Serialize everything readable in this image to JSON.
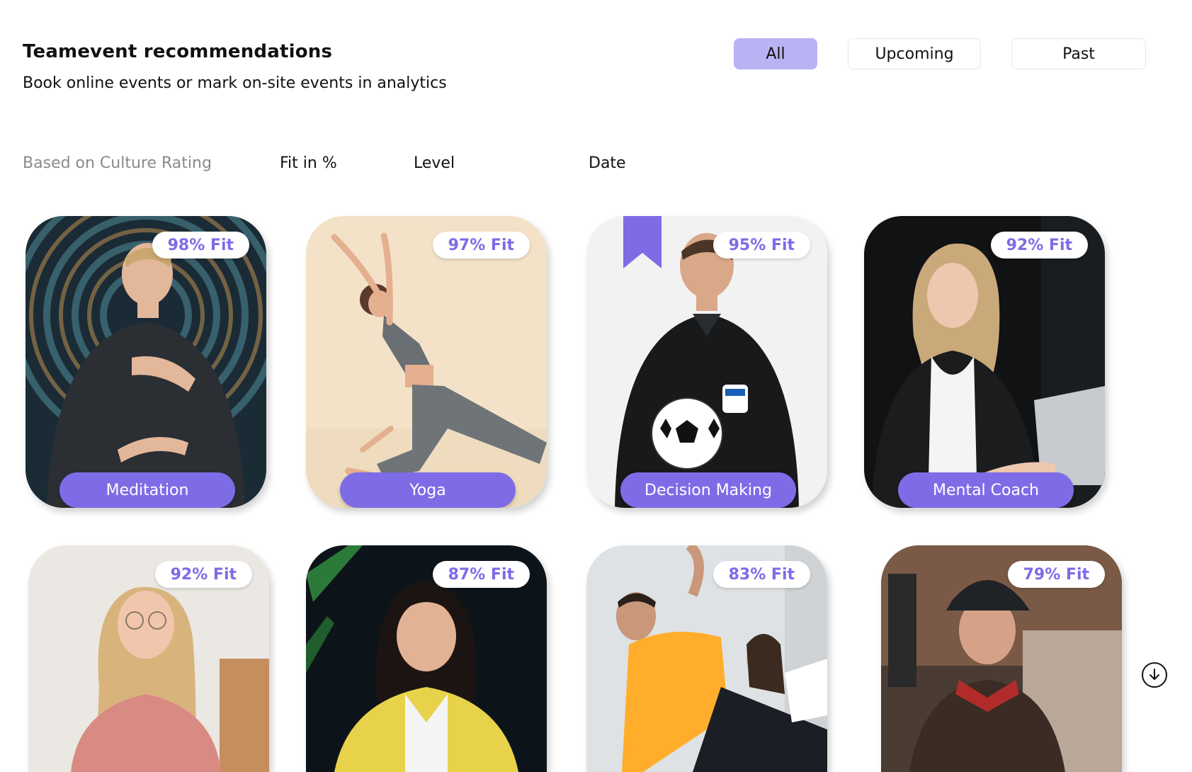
{
  "header": {
    "title": "Teamevent recommendations",
    "subtitle": "Book online events or mark on-site events in analytics"
  },
  "segments": {
    "all": "All",
    "upcoming": "Upcoming",
    "past": "Past",
    "active": "All"
  },
  "filters": {
    "based_on": "Based on Culture Rating",
    "fit": "Fit in %",
    "level": "Level",
    "date": "Date"
  },
  "colors": {
    "accent": "#7e6ce6",
    "accent_light": "#b9b2f3",
    "fit_text": "#7d6ce6"
  },
  "cards": [
    {
      "fit": "98% Fit",
      "label": "Meditation"
    },
    {
      "fit": "97% Fit",
      "label": "Yoga"
    },
    {
      "fit": "95% Fit",
      "label": "Decision Making",
      "bookmarked": true
    },
    {
      "fit": "92% Fit",
      "label": "Mental Coach"
    },
    {
      "fit": "92% Fit"
    },
    {
      "fit": "87% Fit"
    },
    {
      "fit": "83% Fit"
    },
    {
      "fit": "79% Fit"
    }
  ],
  "icons": {
    "bookmark": "bookmark-icon",
    "scroll": "arrow-down-circle-icon"
  }
}
